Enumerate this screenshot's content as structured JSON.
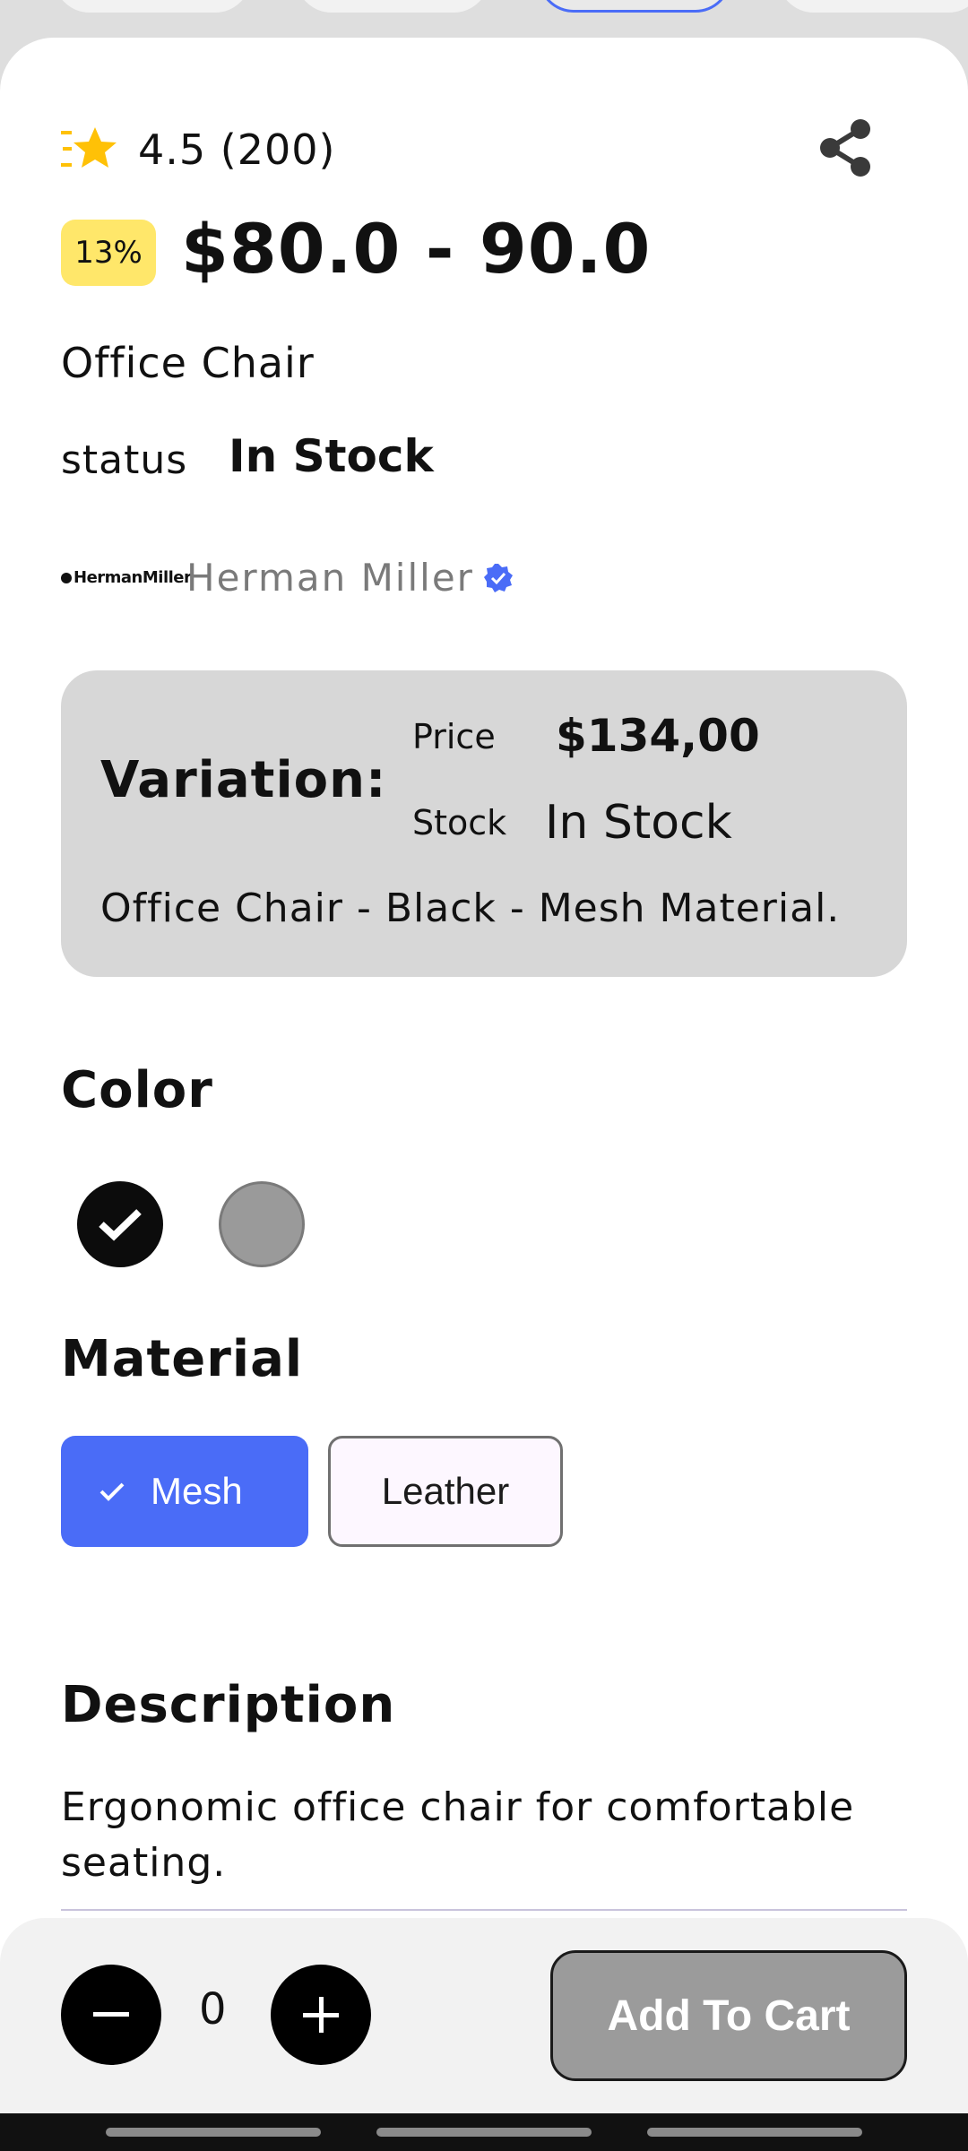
{
  "rating": {
    "value": "4.5 (200)"
  },
  "price": {
    "discount": "13%",
    "range": "$80.0 - 90.0"
  },
  "product": {
    "name": "Office Chair",
    "status_label": "status",
    "status_value": "In Stock",
    "brand_logo_text": "HermanMiller",
    "brand_name": "Herman Miller"
  },
  "variation": {
    "title": "Variation:",
    "price_label": "Price",
    "price_value": "$134,00",
    "stock_label": "Stock",
    "stock_value": "In Stock",
    "description": "Office Chair - Black - Mesh Material."
  },
  "color": {
    "title": "Color",
    "options": [
      {
        "name": "black",
        "hex": "#0c0c0c",
        "selected": true
      },
      {
        "name": "grey",
        "hex": "#9a9a9a",
        "selected": false
      }
    ]
  },
  "material": {
    "title": "Material",
    "options": [
      {
        "label": "Mesh",
        "selected": true
      },
      {
        "label": "Leather",
        "selected": false
      }
    ]
  },
  "description": {
    "title": "Description",
    "text": "Ergonomic office chair for comfortable seating."
  },
  "cart": {
    "quantity": "0",
    "add_label": "Add To Cart"
  },
  "colors": {
    "accent": "#4a6cf7",
    "discount_bg": "#ffe76a",
    "star": "#ffc107"
  }
}
